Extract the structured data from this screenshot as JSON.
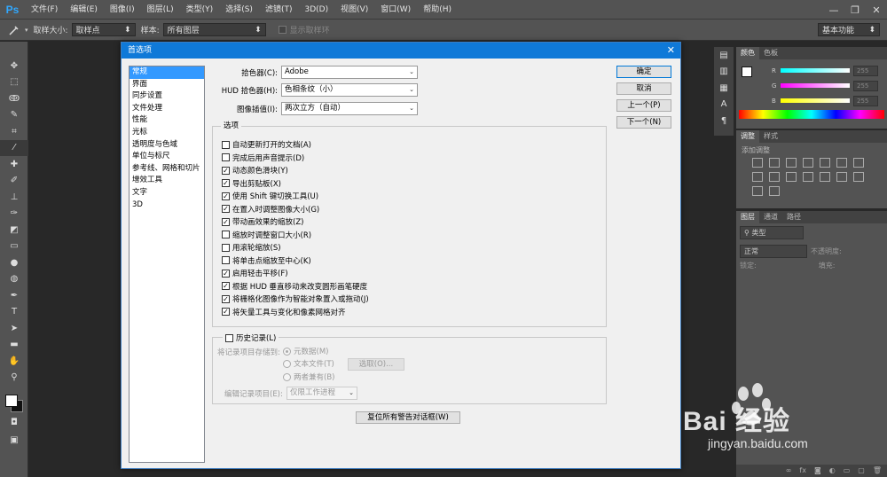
{
  "menubar": {
    "logo": "Ps",
    "items": [
      "文件(F)",
      "编辑(E)",
      "图像(I)",
      "图层(L)",
      "类型(Y)",
      "选择(S)",
      "滤镜(T)",
      "3D(D)",
      "视图(V)",
      "窗口(W)",
      "帮助(H)"
    ],
    "minimize": "—",
    "restore": "❐",
    "close": "✕"
  },
  "optbar": {
    "sample_size_label": "取样大小:",
    "sample_size_value": "取样点",
    "sample_label": "样本:",
    "sample_value": "所有图层",
    "show_ring_label": "显示取样环",
    "workspace_value": "基本功能"
  },
  "panels": {
    "color_tabs": [
      "颜色",
      "色板"
    ],
    "color_values": [
      "255",
      "255",
      "255"
    ],
    "color_channel_labels": [
      "R",
      "G",
      "B"
    ],
    "adjust_tabs": [
      "调整",
      "样式"
    ],
    "adjust_add": "添加调整",
    "layers_tabs": [
      "图层",
      "通道",
      "路径"
    ],
    "layers_kind": "类型",
    "layers_blend": "正常",
    "layers_opacity": "不透明度:",
    "layers_lock": "锁定:",
    "layers_fill": "填充:"
  },
  "dialog": {
    "title": "首选项",
    "close": "✕",
    "categories": [
      "常规",
      "界面",
      "同步设置",
      "文件处理",
      "性能",
      "光标",
      "透明度与色域",
      "单位与标尺",
      "参考线、网格和切片",
      "增效工具",
      "文字",
      "3D"
    ],
    "selected_category": "常规",
    "color_picker_label": "拾色器(C):",
    "color_picker_value": "Adobe",
    "hud_picker_label": "HUD 拾色器(H):",
    "hud_picker_value": "色相条纹（小）",
    "interp_label": "图像插值(I):",
    "interp_value": "两次立方（自动）",
    "options_title": "选项",
    "options": [
      {
        "label": "自动更新打开的文档(A)",
        "checked": false
      },
      {
        "label": "完成后用声音提示(D)",
        "checked": false
      },
      {
        "label": "动态颜色滑块(Y)",
        "checked": true
      },
      {
        "label": "导出剪贴板(X)",
        "checked": true
      },
      {
        "label": "使用 Shift 键切换工具(U)",
        "checked": true
      },
      {
        "label": "在置入时调整图像大小(G)",
        "checked": true
      },
      {
        "label": "带动画效果的缩放(Z)",
        "checked": true
      },
      {
        "label": "缩放时调整窗口大小(R)",
        "checked": false
      },
      {
        "label": "用滚轮缩放(S)",
        "checked": false
      },
      {
        "label": "将单击点缩放至中心(K)",
        "checked": false
      },
      {
        "label": "启用轻击平移(F)",
        "checked": true
      },
      {
        "label": "根据 HUD 垂直移动来改变圆形画笔硬度",
        "checked": true
      },
      {
        "label": "将栅格化图像作为智能对象置入或拖动(J)",
        "checked": true
      },
      {
        "label": "将矢量工具与变化和像素网格对齐",
        "checked": true
      }
    ],
    "history_title": "历史记录(L)",
    "history_save_label": "将记录项目存储到:",
    "history_radio_meta": "元数据(M)",
    "history_radio_text": "文本文件(T)",
    "history_radio_both": "两者兼有(B)",
    "history_choose_btn": "选取(O)...",
    "history_edit_label": "编辑记录项目(E):",
    "history_edit_value": "仅限工作进程",
    "reset_warnings_btn": "复位所有警告对话框(W)",
    "ok_btn": "确定",
    "cancel_btn": "取消",
    "prev_btn": "上一个(P)",
    "next_btn": "下一个(N)"
  },
  "watermark": {
    "brand": "Bai 经验",
    "url": "jingyan.baidu.com"
  }
}
